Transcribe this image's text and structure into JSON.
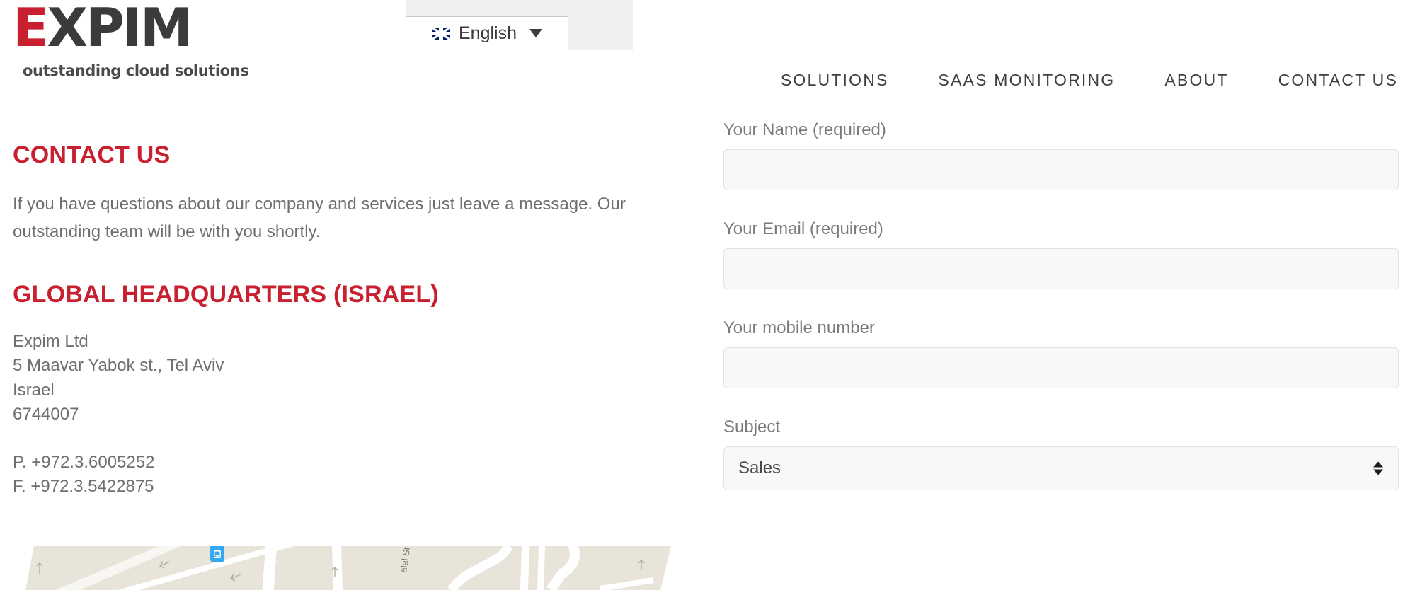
{
  "header": {
    "logo": {
      "word_first": "E",
      "word_rest": "XPIM",
      "tagline": "outstanding cloud solutions"
    },
    "language_switcher": {
      "label": "English",
      "flag_icon": "uk-flag-icon",
      "caret_icon": "chevron-down-icon"
    },
    "nav": [
      {
        "label": "SOLUTIONS"
      },
      {
        "label": "SAAS MONITORING"
      },
      {
        "label": "ABOUT"
      },
      {
        "label": "CONTACT US"
      }
    ]
  },
  "left": {
    "contact_title": "CONTACT US",
    "intro": "If you have questions about our company and services just leave a message. Our outstanding team will be with you shortly.",
    "hq_title": "GLOBAL HEADQUARTERS (ISRAEL)",
    "address": [
      "Expim Ltd",
      "5 Maavar Yabok st., Tel Aviv",
      "Israel",
      "6744007"
    ],
    "phone": "P. +972.3.6005252",
    "fax": "F. +972.3.5422875",
    "map": {
      "street_label": "alal St",
      "marker_icon": "transit-station-marker-icon"
    }
  },
  "form": {
    "fields": [
      {
        "label": "Your Name (required)",
        "value": "",
        "placeholder": ""
      },
      {
        "label": "Your Email (required)",
        "value": "",
        "placeholder": ""
      },
      {
        "label": "Your mobile number",
        "value": "",
        "placeholder": ""
      }
    ],
    "subject": {
      "label": "Subject",
      "selected": "Sales",
      "arrows_icon": "sort-updown-icon"
    }
  },
  "colors": {
    "brand_red": "#c8202f",
    "logo_dark": "#3b3b3b",
    "text_gray": "#6f6f6f",
    "label_gray": "#7a7a7a",
    "field_bg": "#f8f8f8",
    "field_border": "#e2e2e2",
    "lang_bg": "#efefef",
    "map_bg": "#e8e4da"
  }
}
